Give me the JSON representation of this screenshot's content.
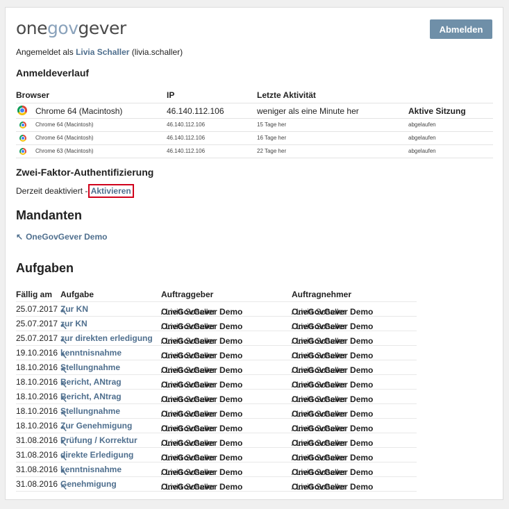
{
  "header": {
    "logo": {
      "one": "one",
      "gov": "gov",
      "gever": "gever"
    },
    "logout_label": "Abmelden"
  },
  "login": {
    "prefix": "Angemeldet als",
    "name": "Livia Schaller",
    "user": "(livia.schaller)"
  },
  "history": {
    "title": "Anmeldeverlauf",
    "columns": {
      "browser": "Browser",
      "ip": "IP",
      "activity": "Letzte Aktivität"
    },
    "rows": [
      {
        "browser": "Chrome 64 (Macintosh)",
        "ip": "46.140.112.106",
        "activity": "weniger als eine Minute her",
        "status": "Aktive Sitzung"
      },
      {
        "browser": "Chrome 64 (Macintosh)",
        "ip": "46.140.112.106",
        "activity": "15 Tage her",
        "status": "abgelaufen"
      },
      {
        "browser": "Chrome 64 (Macintosh)",
        "ip": "46.140.112.106",
        "activity": "16 Tage her",
        "status": "abgelaufen"
      },
      {
        "browser": "Chrome 63 (Macintosh)",
        "ip": "46.140.112.106",
        "activity": "22 Tage her",
        "status": "abgelaufen"
      }
    ]
  },
  "twofactor": {
    "title": "Zwei-Faktor-Authentifizierung",
    "status": "Derzeit deaktiviert -",
    "action": "Aktivieren"
  },
  "mandanten": {
    "title": "Mandanten",
    "item": "OneGovGever Demo"
  },
  "aufgaben": {
    "title": "Aufgaben",
    "columns": {
      "due": "Fällig am",
      "task": "Aufgabe",
      "issuer": "Auftraggeber",
      "assignee": "Auftragnehmer"
    },
    "rows": [
      {
        "due": "25.07.2017",
        "task": "Zur KN",
        "org1": "OneGovGever Demo",
        "p1": " / Livia Schaller",
        "org2": "OneGovGever Demo",
        "p2": " / Livia Schaller"
      },
      {
        "due": "25.07.2017",
        "task": "zur KN",
        "org1": "OneGovGever Demo",
        "p1": " / Livia Schaller",
        "org2": "OneGovGever Demo",
        "p2": " / Livia Schaller"
      },
      {
        "due": "25.07.2017",
        "task": "zur direkten erledigung",
        "org1": "OneGovGever Demo",
        "p1": " / Livia Schaller",
        "org2": "OneGovGever Demo",
        "p2": " / Livia Schaller"
      },
      {
        "due": "19.10.2016",
        "task": "kenntnisnahme",
        "org1": "OneGovGever Demo",
        "p1": " / Livia Schaller",
        "org2": "OneGovGever Demo",
        "p2": " / Livia Schaller"
      },
      {
        "due": "18.10.2016",
        "task": "Stellungnahme",
        "org1": "OneGovGever Demo",
        "p1": " / Livia Schaller",
        "org2": "OneGovGever Demo",
        "p2": " / Livia Schaller"
      },
      {
        "due": "18.10.2016",
        "task": "Bericht, ANtrag",
        "org1": "OneGovGever Demo",
        "p1": " / Livia Schaller",
        "org2": "OneGovGever Demo",
        "p2": " / Livia Schaller"
      },
      {
        "due": "18.10.2016",
        "task": "Bericht, ANtrag",
        "org1": "OneGovGever Demo",
        "p1": " / Livia Schaller",
        "org2": "OneGovGever Demo",
        "p2": " / Livia Schaller"
      },
      {
        "due": "18.10.2016",
        "task": "Stellungnahme",
        "org1": "OneGovGever Demo",
        "p1": " / Livia Schaller",
        "org2": "OneGovGever Demo",
        "p2": " / Livia Schaller"
      },
      {
        "due": "18.10.2016",
        "task": "Zur Genehmigung",
        "org1": "OneGovGever Demo",
        "p1": " / Livia Schaller",
        "org2": "OneGovGever Demo",
        "p2": " / Livia Schaller"
      },
      {
        "due": "31.08.2016",
        "task": "Prüfung / Korrektur",
        "org1": "OneGovGever Demo",
        "p1": " / Livia Schaller",
        "org2": "OneGovGever Demo",
        "p2": " / Livia Schaller"
      },
      {
        "due": "31.08.2016",
        "task": "direkte Erledigung",
        "org1": "OneGovGever Demo",
        "p1": " / Livia Schaller",
        "org2": "OneGovGever Demo",
        "p2": " / Livia Schaller"
      },
      {
        "due": "31.08.2016",
        "task": "kenntnisnahme",
        "org1": "OneGovGever Demo",
        "p1": " / Livia Schaller",
        "org2": "OneGovGever Demo",
        "p2": " / Livia Schaller"
      },
      {
        "due": "31.08.2016",
        "task": "Genehmigung",
        "org1": "OneGovGever Demo",
        "p1": " / Livia Schaller",
        "org2": "OneGovGever Demo",
        "p2": " / Livia Schaller"
      }
    ]
  },
  "icons": {
    "browser": "chrome-icon",
    "arrow": "north-west-arrow-icon"
  }
}
